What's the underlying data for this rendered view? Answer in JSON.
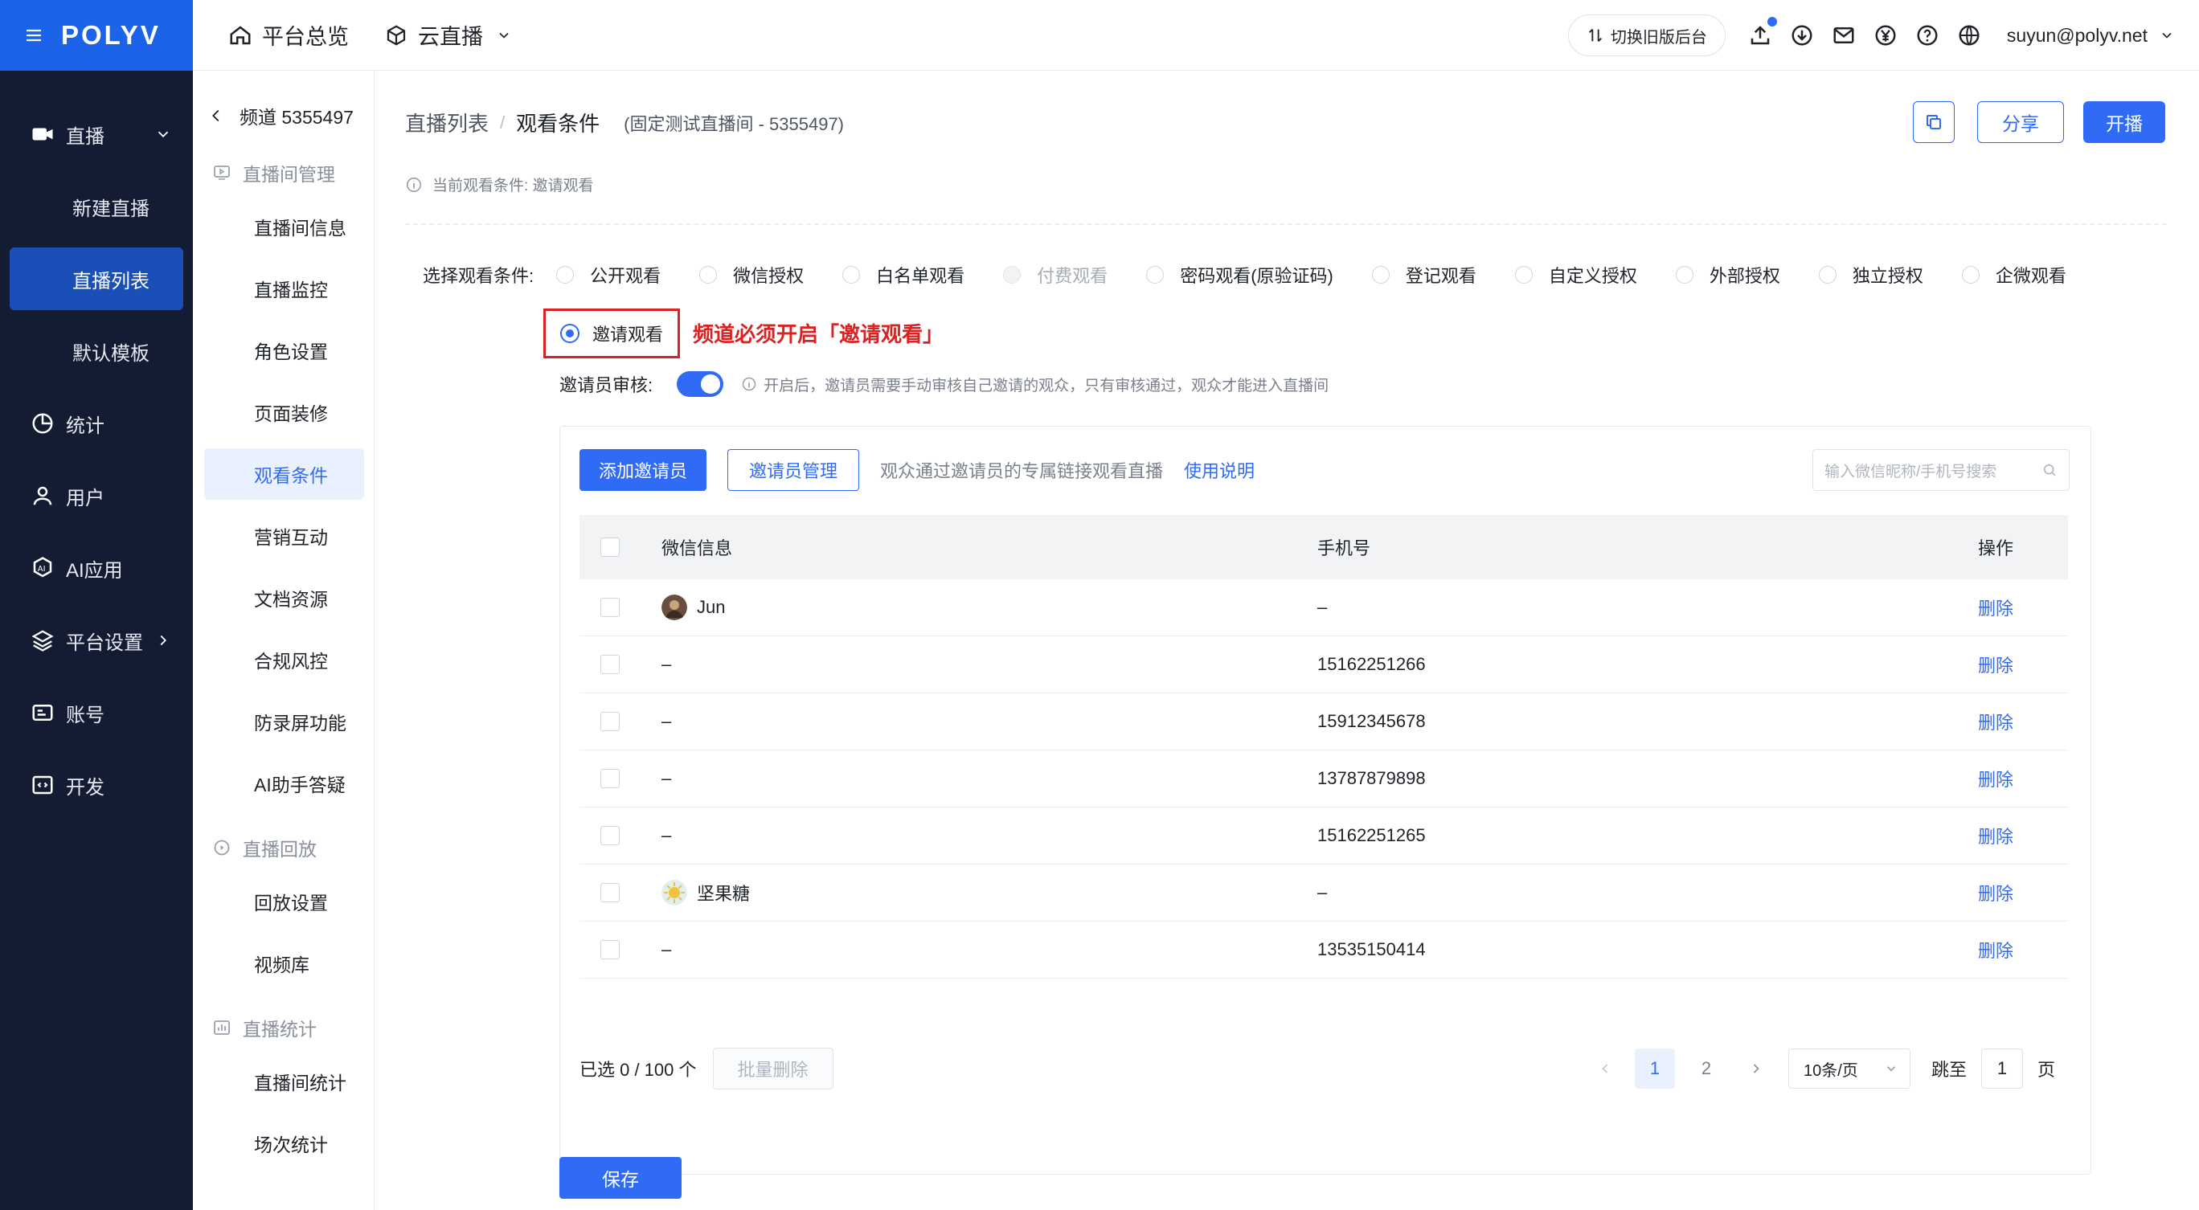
{
  "brand": {
    "logo": "POLYV"
  },
  "sidebar": {
    "items": [
      {
        "label": "直播",
        "icon": "video-camera-icon"
      },
      {
        "label": "新建直播"
      },
      {
        "label": "直播列表"
      },
      {
        "label": "默认模板"
      },
      {
        "label": "统计",
        "icon": "pie-chart-icon"
      },
      {
        "label": "用户",
        "icon": "user-icon"
      },
      {
        "label": "AI应用",
        "icon": "ai-icon"
      },
      {
        "label": "平台设置",
        "icon": "layers-icon"
      },
      {
        "label": "账号",
        "icon": "id-card-icon"
      },
      {
        "label": "开发",
        "icon": "code-icon"
      }
    ]
  },
  "topbar": {
    "overview": "平台总览",
    "cloud_live": "云直播",
    "switch_old": "切换旧版后台",
    "user_email": "suyun@polyv.net"
  },
  "subnav": {
    "back_label": "频道 5355497",
    "group1": "直播间管理",
    "items1": [
      "直播间信息",
      "直播监控",
      "角色设置",
      "页面装修",
      "观看条件",
      "营销互动",
      "文档资源",
      "合规风控",
      "防录屏功能",
      "AI助手答疑"
    ],
    "group2": "直播回放",
    "items2": [
      "回放设置",
      "视频库"
    ],
    "group3": "直播统计",
    "items3": [
      "直播间统计",
      "场次统计"
    ]
  },
  "header": {
    "crumb_parent": "直播列表",
    "crumb_sep": "/",
    "crumb_current": "观看条件",
    "channel_info": "(固定测试直播间 - 5355497)",
    "share": "分享",
    "start": "开播",
    "current_condition": "当前观看条件: 邀请观看"
  },
  "conditions": {
    "label": "选择观看条件:",
    "options": [
      "公开观看",
      "微信授权",
      "白名单观看",
      "付费观看",
      "密码观看(原验证码)",
      "登记观看",
      "自定义授权",
      "外部授权",
      "独立授权",
      "企微观看"
    ],
    "selected": "邀请观看",
    "annotation": "频道必须开启「邀请观看」"
  },
  "review": {
    "label": "邀请员审核:",
    "enabled": true,
    "hint": "开启后，邀请员需要手动审核自己邀请的观众，只有审核通过，观众才能进入直播间"
  },
  "panel": {
    "add_btn": "添加邀请员",
    "manage_btn": "邀请员管理",
    "desc": "观众通过邀请员的专属链接观看直播",
    "help_link": "使用说明",
    "search_placeholder": "输入微信昵称/手机号搜索",
    "columns": [
      "微信信息",
      "手机号",
      "操作"
    ],
    "rows": [
      {
        "wechat": "Jun",
        "phone": "–",
        "action": "删除"
      },
      {
        "wechat": "–",
        "phone": "15162251266",
        "action": "删除"
      },
      {
        "wechat": "–",
        "phone": "15912345678",
        "action": "删除"
      },
      {
        "wechat": "–",
        "phone": "13787879898",
        "action": "删除"
      },
      {
        "wechat": "–",
        "phone": "15162251265",
        "action": "删除"
      },
      {
        "wechat": "坚果糖",
        "phone": "–",
        "action": "删除"
      },
      {
        "wechat": "–",
        "phone": "13535150414",
        "action": "删除"
      }
    ],
    "selected_count": "已选 0 / 100 个",
    "batch_delete": "批量删除",
    "pages": [
      "1",
      "2"
    ],
    "page_size": "10条/页",
    "jump_label": "跳至",
    "jump_value": "1",
    "page_unit": "页"
  },
  "save": "保存",
  "colors": {
    "primary": "#2f6bf5",
    "sidebar_bg": "#141c34",
    "brand_bg": "#1b63e8",
    "annotation": "#d92323"
  }
}
